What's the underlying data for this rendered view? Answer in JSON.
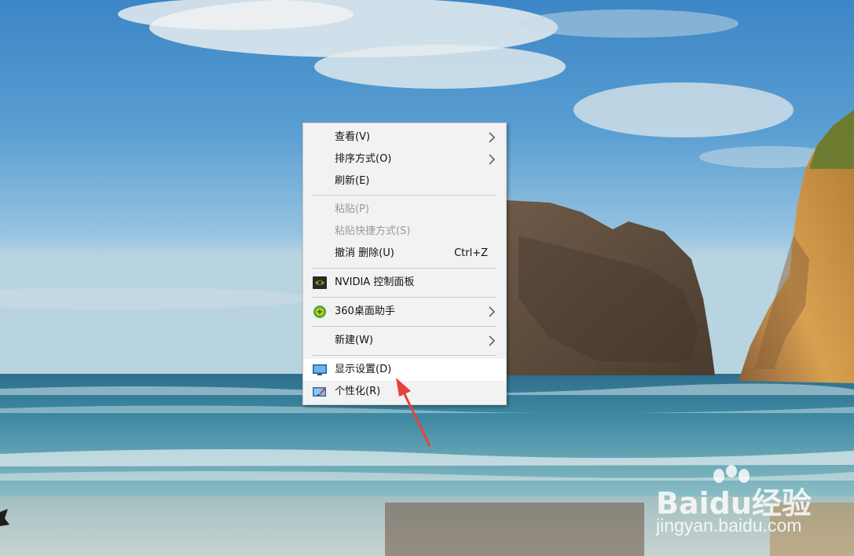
{
  "context_menu": {
    "view": {
      "label": "查看(V)",
      "icon": "",
      "has_submenu": true
    },
    "sort_by": {
      "label": "排序方式(O)",
      "has_submenu": true
    },
    "refresh": {
      "label": "刷新(E)"
    },
    "paste": {
      "label": "粘贴(P)",
      "disabled": true
    },
    "paste_shortcut": {
      "label": "粘贴快捷方式(S)",
      "disabled": true
    },
    "undo_delete": {
      "label": "撤消 删除(U)",
      "shortcut": "Ctrl+Z"
    },
    "nvidia": {
      "label": "NVIDIA 控制面板",
      "icon": "nvidia-icon"
    },
    "desktop_assistant_360": {
      "label": "360桌面助手",
      "icon": "360-icon",
      "has_submenu": true
    },
    "new": {
      "label": "新建(W)",
      "has_submenu": true
    },
    "display_settings": {
      "label": "显示设置(D)",
      "icon": "monitor-icon",
      "highlighted": true
    },
    "personalize": {
      "label": "个性化(R)",
      "icon": "personalize-icon"
    }
  },
  "annotation": {
    "arrow_color": "#e8413a"
  },
  "watermark": {
    "brand": "Baidu经验",
    "site": "jingyan.baidu.com"
  },
  "colors": {
    "menu_bg": "#f2f2f2",
    "highlight_bg": "#ffffff",
    "disabled_text": "#9a9a9a"
  }
}
